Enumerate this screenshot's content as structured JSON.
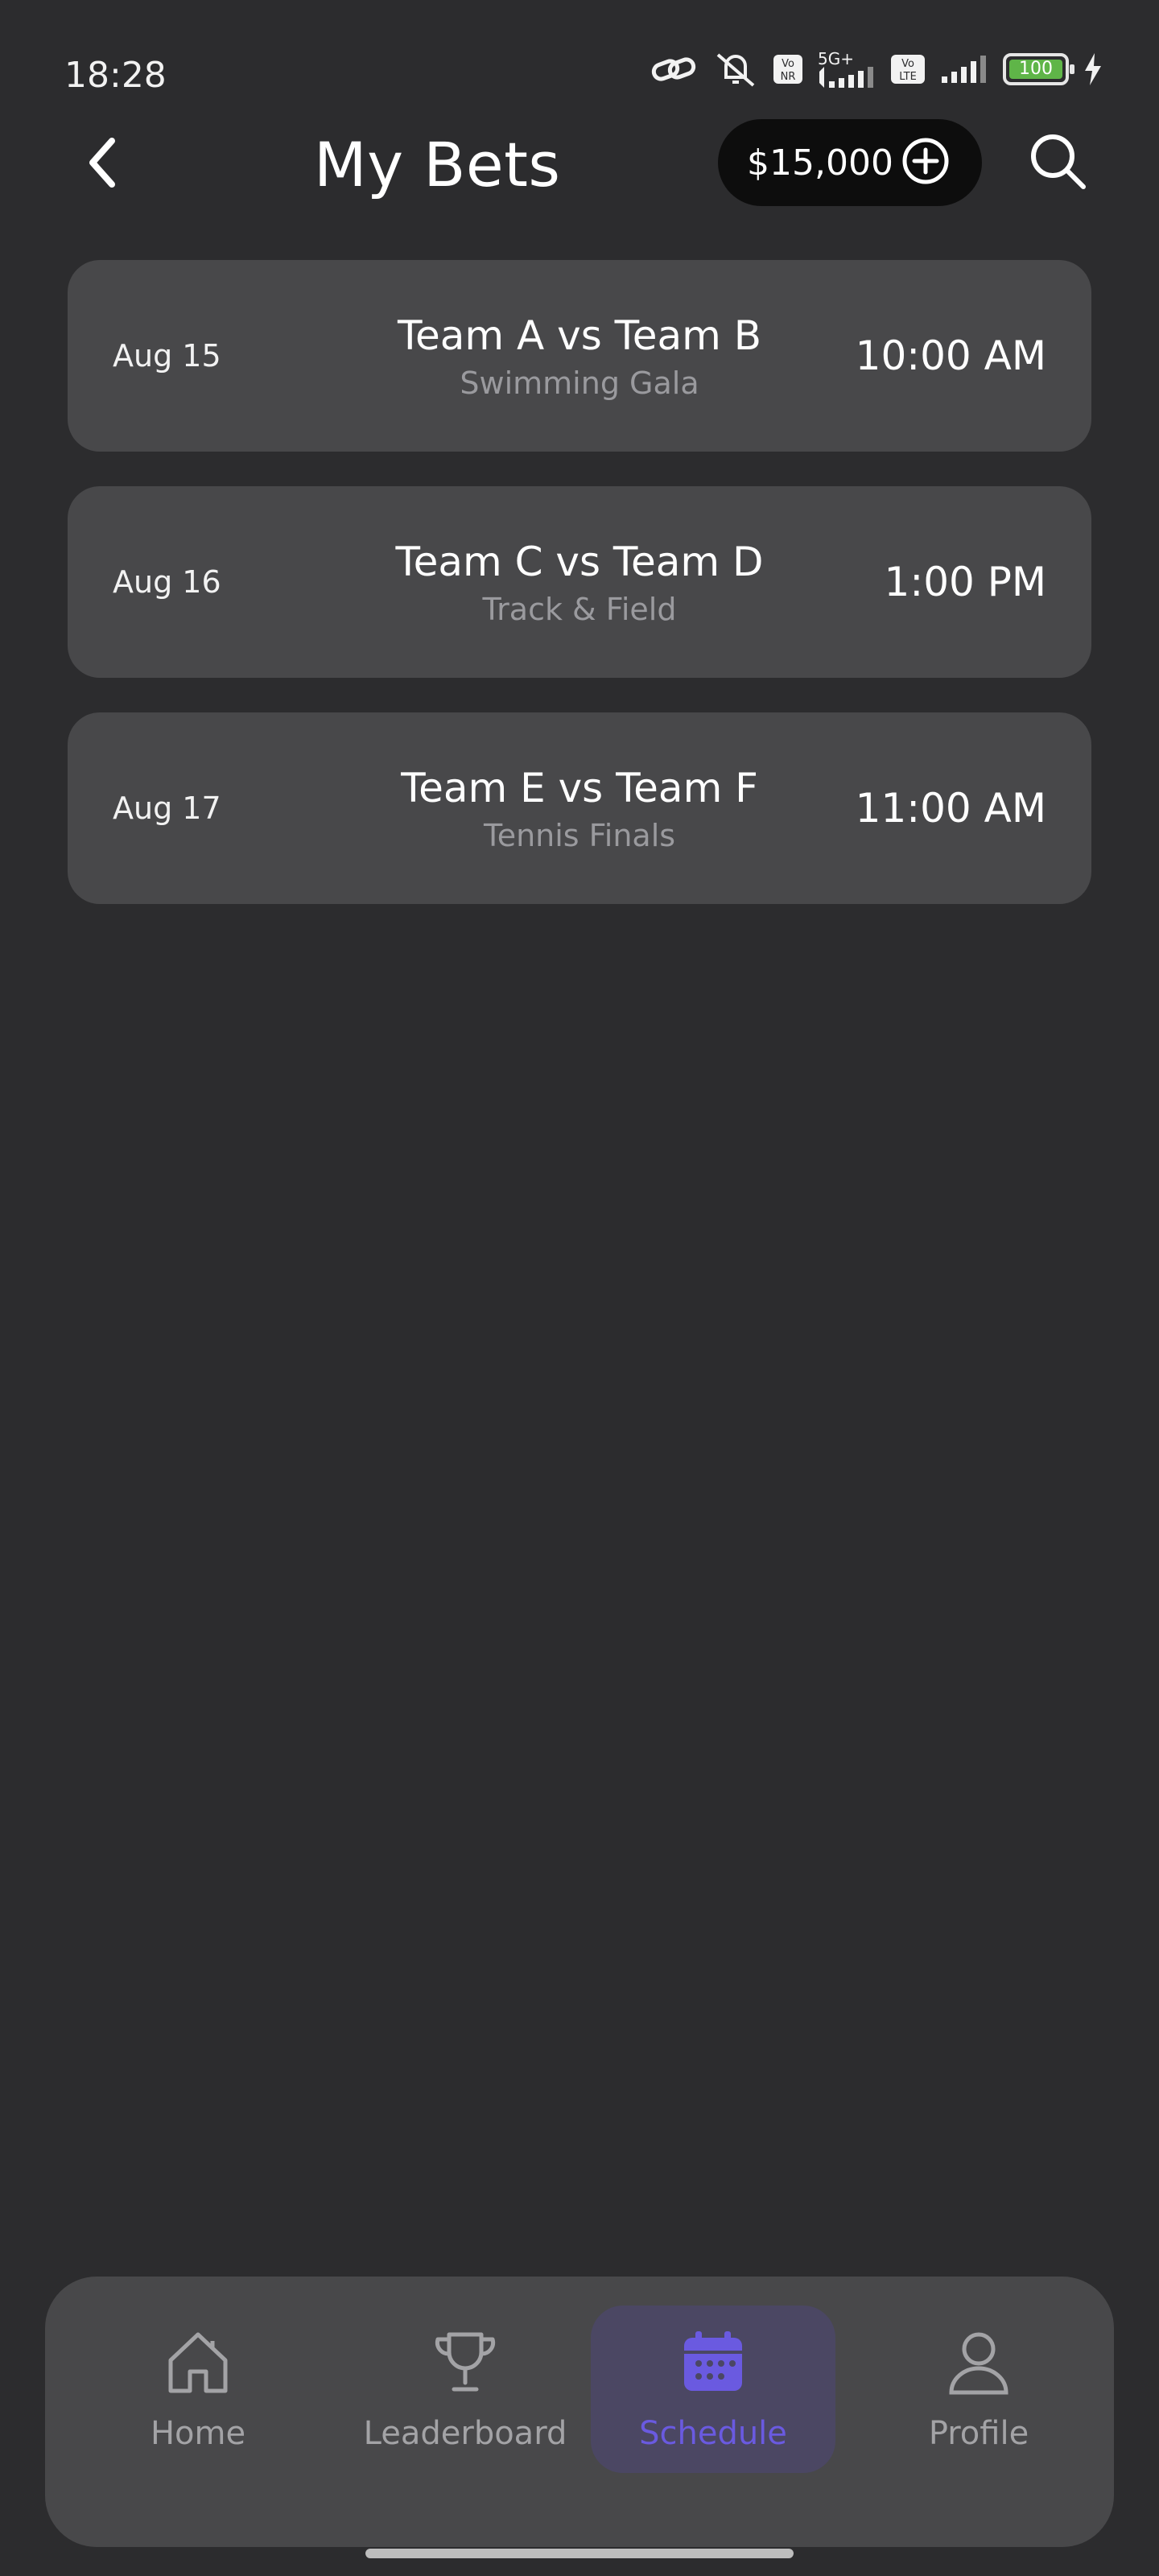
{
  "status_bar": {
    "time": "18:28",
    "network_label": "5G+",
    "volte_1": "Vo NR",
    "volte_2": "Vo LTE",
    "battery_level": "100",
    "icons": [
      "link-icon",
      "mute-icon",
      "signal-icon",
      "battery-icon",
      "charging-icon"
    ]
  },
  "header": {
    "title": "My Bets",
    "balance": "$15,000"
  },
  "bets": [
    {
      "date": "Aug 15",
      "teams": "Team A vs Team B",
      "event": "Swimming Gala",
      "time": "10:00 AM"
    },
    {
      "date": "Aug 16",
      "teams": "Team C vs Team D",
      "event": "Track & Field",
      "time": "1:00 PM"
    },
    {
      "date": "Aug 17",
      "teams": "Team E vs Team F",
      "event": "Tennis Finals",
      "time": "11:00 AM"
    }
  ],
  "nav": {
    "active": "Schedule",
    "items": [
      {
        "label": "Home",
        "icon": "home-icon"
      },
      {
        "label": "Leaderboard",
        "icon": "trophy-icon"
      },
      {
        "label": "Schedule",
        "icon": "calendar-icon"
      },
      {
        "label": "Profile",
        "icon": "profile-icon"
      }
    ]
  },
  "colors": {
    "background": "#2c2c2e",
    "card": "#48484a",
    "accent": "#6a5ae0",
    "pill": "#0d0d0d",
    "battery": "#5fb548"
  }
}
